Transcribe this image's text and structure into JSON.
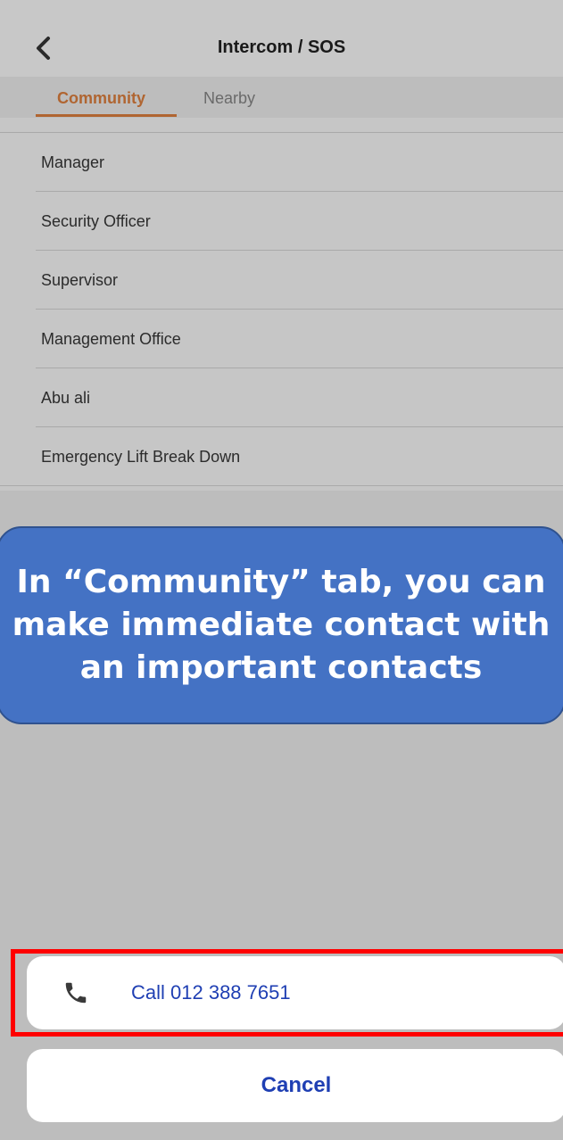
{
  "header": {
    "title": "Intercom / SOS",
    "back_icon": "chevron-left-icon"
  },
  "tabs": [
    {
      "label": "Community",
      "active": true
    },
    {
      "label": "Nearby",
      "active": false
    }
  ],
  "contacts": [
    {
      "label": "Manager"
    },
    {
      "label": "Security Officer"
    },
    {
      "label": "Supervisor"
    },
    {
      "label": "Management Office"
    },
    {
      "label": "Abu ali"
    },
    {
      "label": "Emergency Lift Break Down"
    }
  ],
  "callout": {
    "text": "In “Community” tab, you can make immediate contact with an important contacts"
  },
  "action_sheet": {
    "call_label": "Call 012 388 7651",
    "call_icon": "phone-icon",
    "cancel_label": "Cancel"
  },
  "colors": {
    "accent_tab": "#b06531",
    "action_text": "#1f3fb3",
    "callout_fill": "#4472c4",
    "highlight_border": "#ff0000"
  }
}
